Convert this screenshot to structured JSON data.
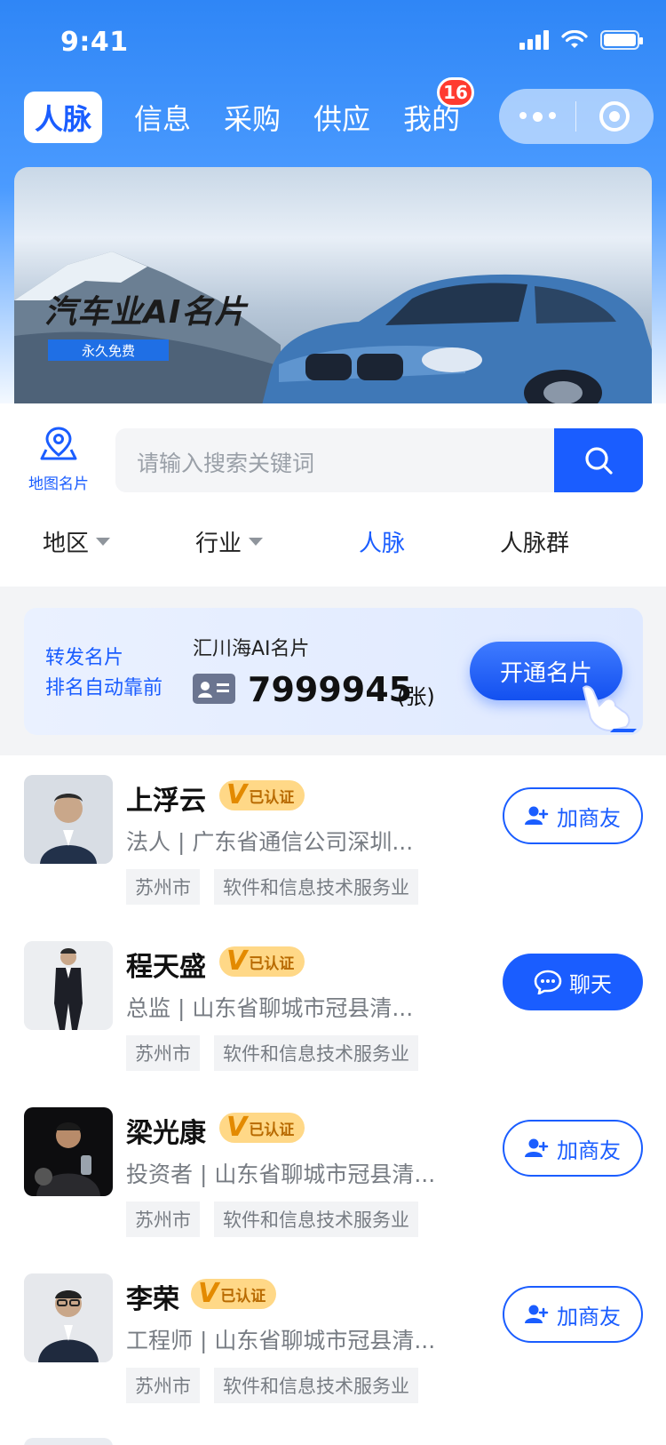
{
  "status_bar": {
    "time": "9:41"
  },
  "tabs": [
    {
      "label": "人脉",
      "active": true
    },
    {
      "label": "信息"
    },
    {
      "label": "采购"
    },
    {
      "label": "供应"
    },
    {
      "label": "我的",
      "badge": "16"
    }
  ],
  "banner": {
    "title": "汽车业AI名片",
    "tag": "永久免费"
  },
  "map_card": {
    "label": "地图名片"
  },
  "search": {
    "placeholder": "请输入搜索关键词"
  },
  "filters": [
    {
      "label": "地区",
      "dropdown": true
    },
    {
      "label": "行业",
      "dropdown": true
    },
    {
      "label": "人脉",
      "active": true
    },
    {
      "label": "人脉群"
    }
  ],
  "promo": {
    "left_line1": "转发名片",
    "left_line2": "排名自动靠前",
    "title": "汇川海AI名片",
    "count": "7999945",
    "unit": "(张)",
    "cta": "开通名片"
  },
  "people": [
    {
      "name": "上浮云",
      "verified": "已认证",
      "desc": "法人 | 广东省通信公司深圳...",
      "tags": [
        "苏州市",
        "软件和信息技术服务业"
      ],
      "action": "加商友",
      "action_type": "outline"
    },
    {
      "name": "程天盛",
      "verified": "已认证",
      "desc": "总监 | 山东省聊城市冠县清...",
      "tags": [
        "苏州市",
        "软件和信息技术服务业"
      ],
      "action": "聊天",
      "action_type": "solid"
    },
    {
      "name": "梁光康",
      "verified": "已认证",
      "desc": "投资者 | 山东省聊城市冠县清...",
      "tags": [
        "苏州市",
        "软件和信息技术服务业"
      ],
      "action": "加商友",
      "action_type": "outline"
    },
    {
      "name": "李荣",
      "verified": "已认证",
      "desc": "工程师 | 山东省聊城市冠县清...",
      "tags": [
        "苏州市",
        "软件和信息技术服务业"
      ],
      "action": "加商友",
      "action_type": "outline"
    }
  ],
  "colors": {
    "primary": "#1a5dff",
    "badge": "#ff3b30",
    "verified_bg": "#ffd887"
  }
}
